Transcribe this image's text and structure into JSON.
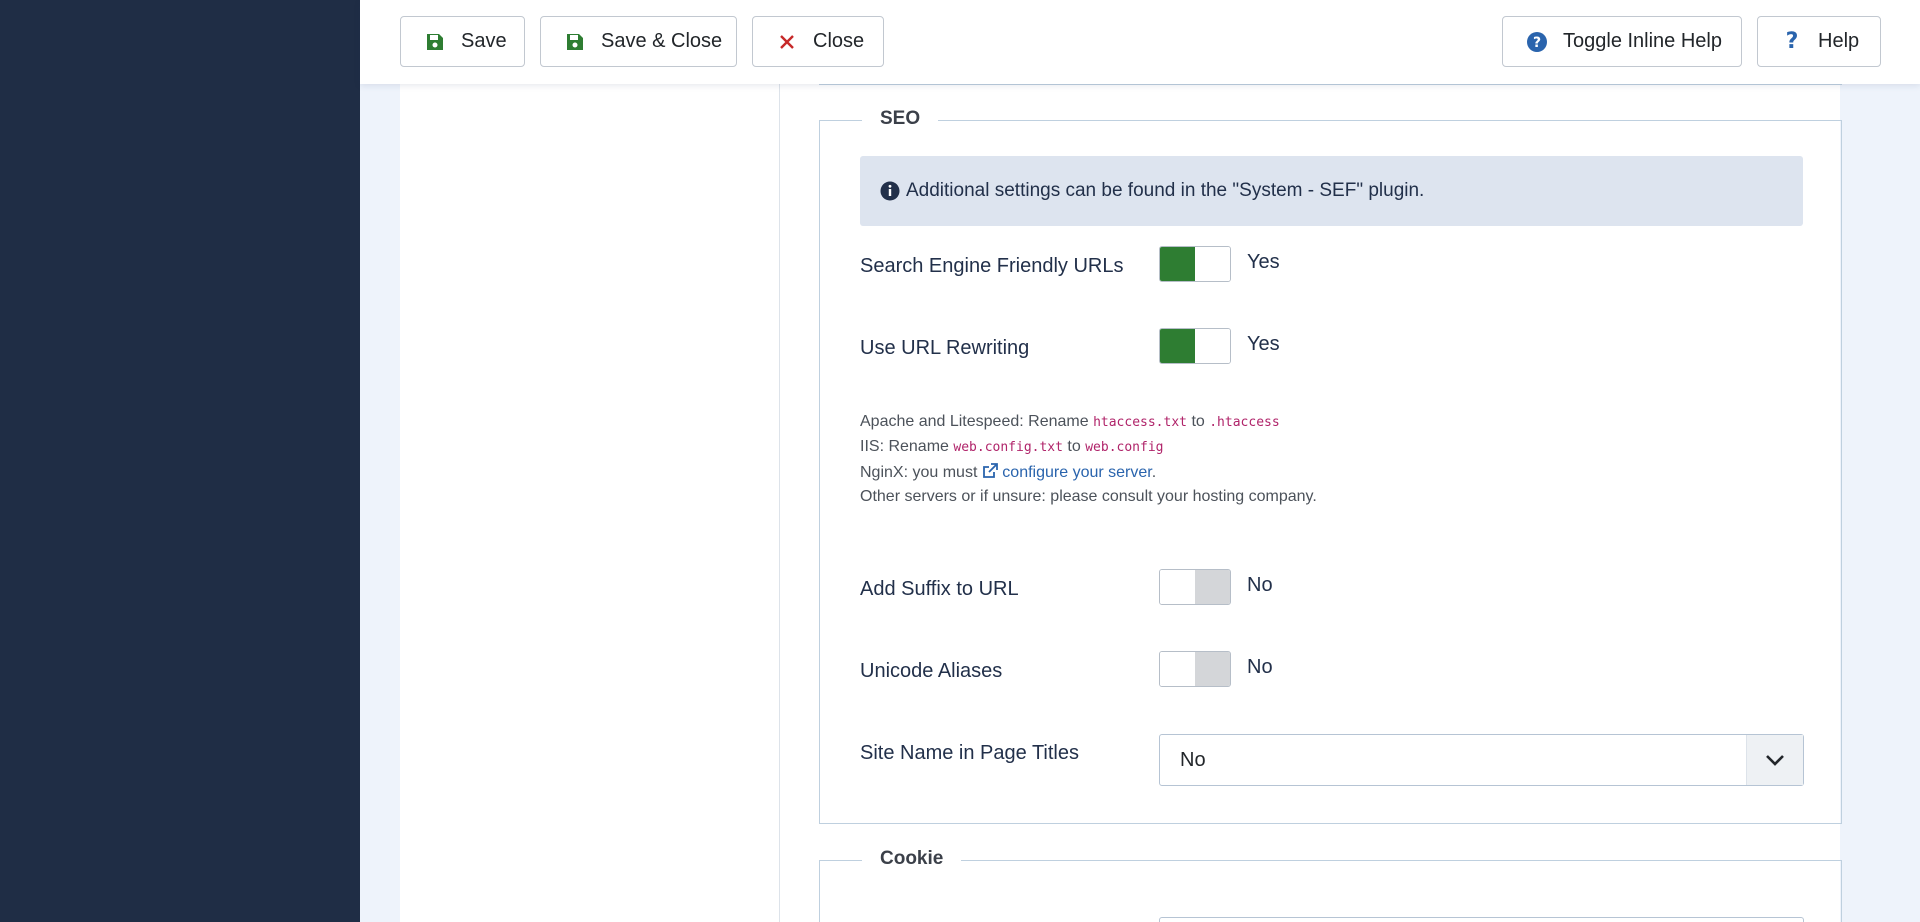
{
  "toolbar": {
    "save_label": "Save",
    "save_close_label": "Save & Close",
    "close_label": "Close",
    "toggle_help_label": "Toggle Inline Help",
    "help_label": "Help"
  },
  "seo": {
    "legend": "SEO",
    "alert_text": "Additional settings can be found in the \"System - SEF\" plugin.",
    "sef_urls": {
      "label": "Search Engine Friendly URLs",
      "value": "Yes",
      "on": true
    },
    "url_rewriting": {
      "label": "Use URL Rewriting",
      "value": "Yes",
      "on": true
    },
    "rewrite_notes": {
      "apache_prefix": "Apache and Litespeed: Rename",
      "apache_from": "htaccess.txt",
      "apache_to_word": "to",
      "apache_to": ".htaccess",
      "iis_prefix": "IIS: Rename",
      "iis_from": "web.config.txt",
      "iis_to_word": "to",
      "iis_to": "web.config",
      "nginx_prefix": "NginX: you must",
      "nginx_link": "configure your server",
      "nginx_suffix": ".",
      "other": "Other servers or if unsure: please consult your hosting company."
    },
    "add_suffix": {
      "label": "Add Suffix to URL",
      "value": "No",
      "on": false
    },
    "unicode_aliases": {
      "label": "Unicode Aliases",
      "value": "No",
      "on": false
    },
    "sitename_titles": {
      "label": "Site Name in Page Titles",
      "value": "No"
    }
  },
  "cookie": {
    "legend": "Cookie"
  },
  "colors": {
    "sidebar": "#1f2d45",
    "switch_on": "#2e7d32",
    "save_icon": "#2e7d32",
    "close_icon": "#c62828",
    "help_icon": "#2a64ad"
  }
}
